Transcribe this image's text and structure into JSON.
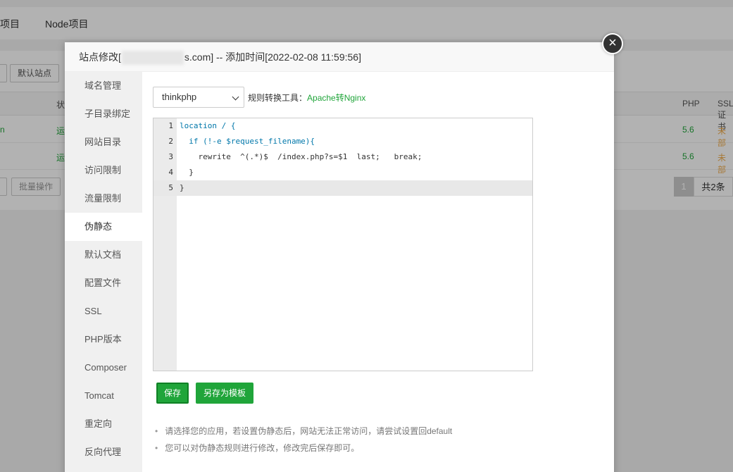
{
  "background": {
    "tabs": [
      "项目",
      "Node项目"
    ],
    "buttons": [
      "默认站点",
      "批量操作"
    ],
    "table": {
      "headers": [
        "状态",
        "PHP",
        "SSL证书"
      ],
      "rows": [
        {
          "status": "运行中",
          "name_tail": "n",
          "php": "5.6",
          "ssl": "未部署"
        },
        {
          "status": "运行中",
          "name_tail": "",
          "php": "5.6",
          "ssl": "未部署"
        }
      ]
    },
    "pagination": {
      "current": "1",
      "total": "共2条"
    }
  },
  "modal": {
    "title_prefix": "站点修改[",
    "title_suffix": "s.com] -- 添加时间[2022-02-08 11:59:56]",
    "close_icon": "close-icon",
    "sidebar": [
      {
        "label": "域名管理"
      },
      {
        "label": "子目录绑定"
      },
      {
        "label": "网站目录"
      },
      {
        "label": "访问限制"
      },
      {
        "label": "流量限制"
      },
      {
        "label": "伪静态"
      },
      {
        "label": "默认文档"
      },
      {
        "label": "配置文件"
      },
      {
        "label": "SSL"
      },
      {
        "label": "PHP版本"
      },
      {
        "label": "Composer"
      },
      {
        "label": "Tomcat"
      },
      {
        "label": "重定向"
      },
      {
        "label": "反向代理"
      }
    ],
    "active_item": "伪静态",
    "rewrite": {
      "select_value": "thinkphp",
      "tool_label": "规则转换工具：",
      "tool_link": "Apache转Nginx",
      "code_lines": [
        {
          "num": "1",
          "text": "location / {"
        },
        {
          "num": "2",
          "text": "  if (!-e $request_filename){"
        },
        {
          "num": "3",
          "text": "    rewrite  ^(.*)$  /index.php?s=$1  last;   break;"
        },
        {
          "num": "4",
          "text": "  }"
        },
        {
          "num": "5",
          "text": "}"
        }
      ],
      "save_label": "保存",
      "save_template_label": "另存为模板",
      "tips": [
        "请选择您的应用，若设置伪静态后，网站无法正常访问，请尝试设置回default",
        "您可以对伪静态规则进行修改，修改完后保存即可。"
      ]
    }
  },
  "colors": {
    "accent": "#20a53a",
    "warning": "#f0ad4e"
  }
}
